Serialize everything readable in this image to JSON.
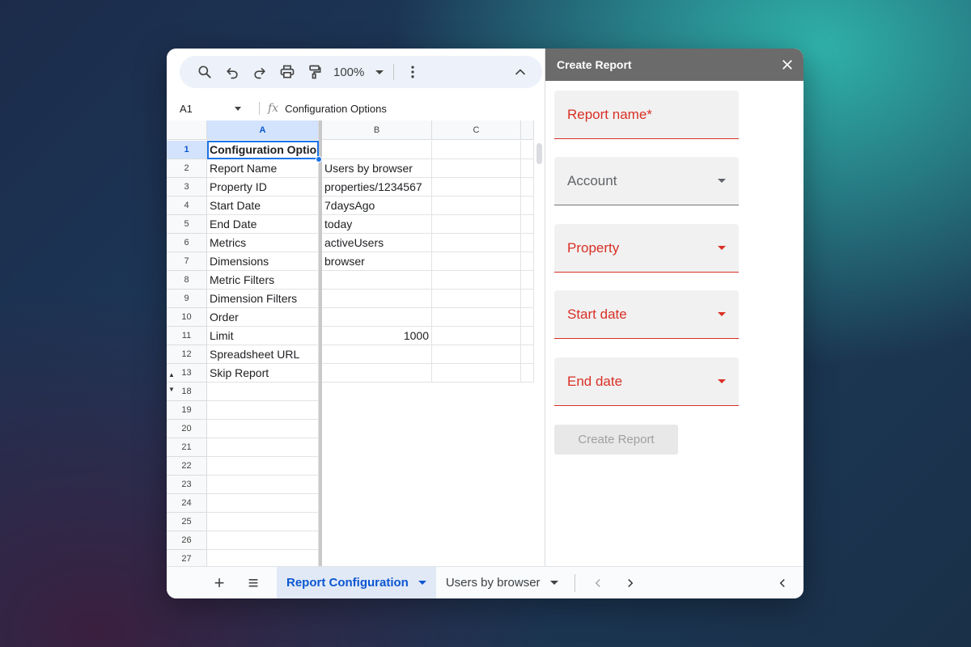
{
  "toolbar": {
    "zoom_label": "100%",
    "icons": [
      "search-icon",
      "undo-icon",
      "redo-icon",
      "print-icon",
      "paint-format-icon",
      "more-vert-icon",
      "chevron-up-icon"
    ]
  },
  "formula_bar": {
    "cell_ref": "A1",
    "fx_label": "fx",
    "content": "Configuration Options"
  },
  "columns": [
    "A",
    "B",
    "C"
  ],
  "rows": [
    {
      "num": "1",
      "a": "Configuration Optio",
      "b": "",
      "c": ""
    },
    {
      "num": "2",
      "a": "Report Name",
      "b": "Users by browser",
      "c": ""
    },
    {
      "num": "3",
      "a": "Property ID",
      "b": "properties/1234567",
      "c": ""
    },
    {
      "num": "4",
      "a": "Start Date",
      "b": "7daysAgo",
      "c": ""
    },
    {
      "num": "5",
      "a": "End Date",
      "b": "today",
      "c": ""
    },
    {
      "num": "6",
      "a": "Metrics",
      "b": "activeUsers",
      "c": ""
    },
    {
      "num": "7",
      "a": "Dimensions",
      "b": "browser",
      "c": ""
    },
    {
      "num": "8",
      "a": "Metric Filters",
      "b": "",
      "c": ""
    },
    {
      "num": "9",
      "a": "Dimension Filters",
      "b": "",
      "c": ""
    },
    {
      "num": "10",
      "a": "Order",
      "b": "",
      "c": ""
    },
    {
      "num": "11",
      "a": "Limit",
      "b": "1000",
      "c": ""
    },
    {
      "num": "12",
      "a": "Spreadsheet URL",
      "b": "",
      "c": ""
    },
    {
      "num": "13",
      "a": "Skip Report",
      "b": "",
      "c": ""
    },
    {
      "num": "18",
      "a": "",
      "b": "",
      "c": ""
    },
    {
      "num": "19",
      "a": "",
      "b": "",
      "c": ""
    },
    {
      "num": "20",
      "a": "",
      "b": "",
      "c": ""
    },
    {
      "num": "21",
      "a": "",
      "b": "",
      "c": ""
    },
    {
      "num": "22",
      "a": "",
      "b": "",
      "c": ""
    },
    {
      "num": "23",
      "a": "",
      "b": "",
      "c": ""
    },
    {
      "num": "24",
      "a": "",
      "b": "",
      "c": ""
    },
    {
      "num": "25",
      "a": "",
      "b": "",
      "c": ""
    },
    {
      "num": "26",
      "a": "",
      "b": "",
      "c": ""
    },
    {
      "num": "27",
      "a": "",
      "b": "",
      "c": ""
    }
  ],
  "tabs": {
    "add_icon": "+",
    "all_sheets_icon": "≡",
    "sheets": [
      {
        "label": "Report Configuration",
        "active": true
      },
      {
        "label": "Users by browser",
        "active": false
      }
    ]
  },
  "panel": {
    "title": "Create Report",
    "fields": [
      {
        "label": "Report name*",
        "type": "text",
        "accent": "error"
      },
      {
        "label": "Account",
        "type": "select",
        "accent": "neutral"
      },
      {
        "label": "Property",
        "type": "select",
        "accent": "error"
      },
      {
        "label": "Start date",
        "type": "select",
        "accent": "error"
      },
      {
        "label": "End date",
        "type": "select",
        "accent": "error"
      }
    ],
    "submit_label": "Create Report"
  },
  "colors": {
    "selection": "#1a73e8",
    "error": "#d93025",
    "panel_header": "#6b6b6b",
    "active_tab": "#0b57d0"
  }
}
